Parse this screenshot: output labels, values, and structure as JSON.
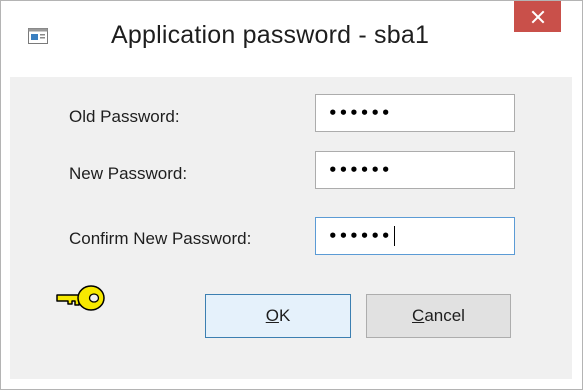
{
  "window": {
    "title": "Application password - sba1",
    "close_symbol": "✕",
    "icons": {
      "app": "application-window-icon",
      "close": "close-icon",
      "key": "key-icon"
    }
  },
  "form": {
    "old_password": {
      "label": "Old Password:",
      "value_masked": "••••••"
    },
    "new_password": {
      "label": "New Password:",
      "value_masked": "••••••"
    },
    "confirm_password": {
      "label": "Confirm New Password:",
      "value_masked": "••••••"
    }
  },
  "buttons": {
    "ok": {
      "mnemonic": "O",
      "rest": "K"
    },
    "cancel": {
      "mnemonic": "C",
      "rest": "ancel"
    }
  },
  "colors": {
    "close_button_bg": "#c9504a",
    "focus_border": "#5b9bd5",
    "default_button_border": "#3c7fb1",
    "key_fill": "#f7e900"
  }
}
